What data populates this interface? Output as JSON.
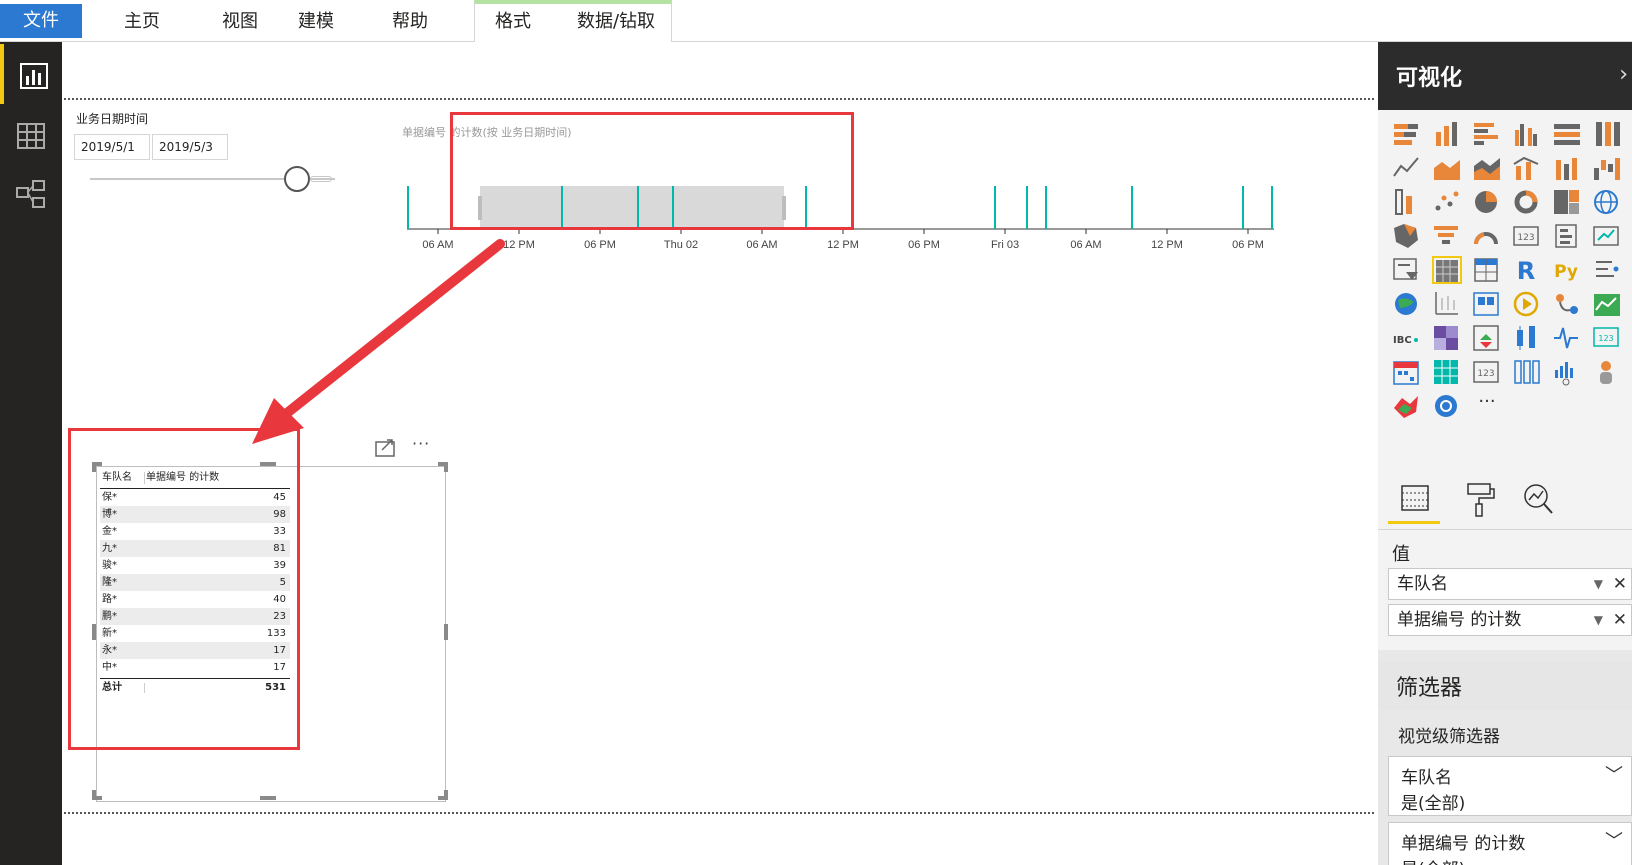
{
  "ribbon": {
    "tabs": [
      "文件",
      "主页",
      "视图",
      "建模",
      "帮助",
      "格式",
      "数据/钻取"
    ]
  },
  "slicer": {
    "title": "业务日期时间",
    "start": "2019/5/1",
    "end": "2019/5/3"
  },
  "timeline": {
    "title": "单据编号 的计数(按 业务日期时间)",
    "ticks": [
      "06 AM",
      "12 PM",
      "06 PM",
      "Thu 02",
      "06 AM",
      "12 PM",
      "06 PM",
      "Fri 03",
      "06 AM",
      "12 PM",
      "06 PM"
    ]
  },
  "table": {
    "col1": "车队名",
    "col2": "单据编号 的计数",
    "rows": [
      {
        "name": "保*",
        "value": "45"
      },
      {
        "name": "博*",
        "value": "98"
      },
      {
        "name": "金*",
        "value": "33"
      },
      {
        "name": "九*",
        "value": "81"
      },
      {
        "name": "骏*",
        "value": "39"
      },
      {
        "name": "隆*",
        "value": "5"
      },
      {
        "name": "路*",
        "value": "40"
      },
      {
        "name": "鹏*",
        "value": "23"
      },
      {
        "name": "新*",
        "value": "133"
      },
      {
        "name": "永*",
        "value": "17"
      },
      {
        "name": "中*",
        "value": "17"
      }
    ],
    "total_label": "总计",
    "total_value": "531",
    "more": "···"
  },
  "pane": {
    "title": "可视化",
    "chevron": "›",
    "more": "···",
    "values_label": "值",
    "fields": [
      "车队名",
      "单据编号 的计数"
    ],
    "filters_title": "筛选器",
    "visual_filters": "视觉级筛选器",
    "filter_cards": [
      {
        "field": "车队名",
        "state": "是(全部)"
      },
      {
        "field": "单据编号 的计数",
        "state": "是(全部)"
      }
    ]
  },
  "colors": {
    "accent": "#2b79d0",
    "teal": "#01b8aa",
    "red": "#e8383d",
    "yellow": "#f2c811"
  }
}
